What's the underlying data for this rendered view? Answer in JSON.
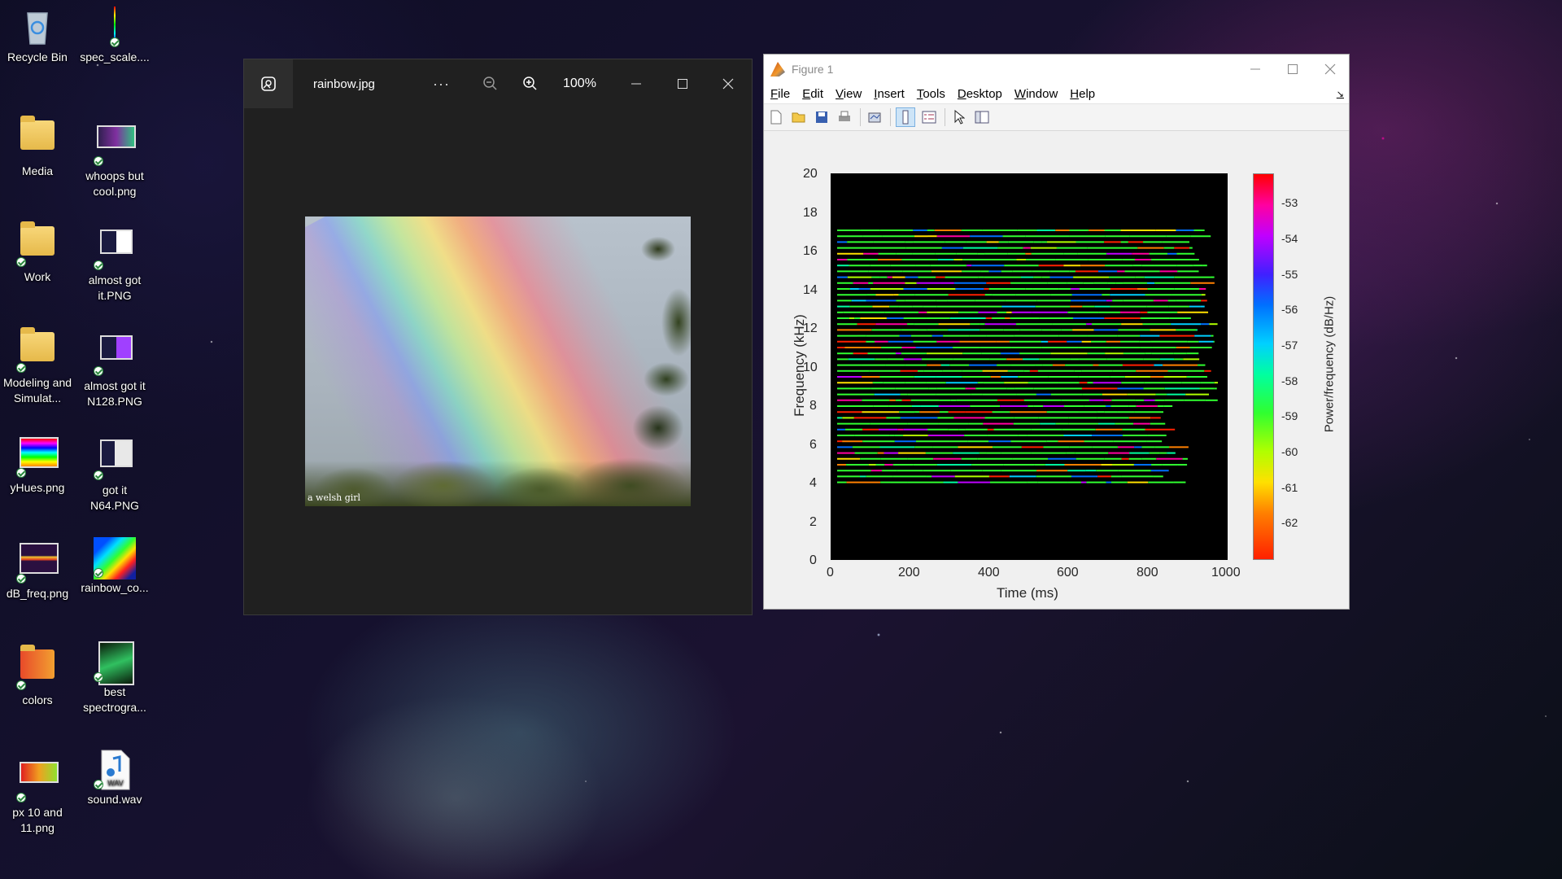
{
  "desktop": {
    "icons": [
      {
        "id": "recycle-bin",
        "label": "Recycle Bin"
      },
      {
        "id": "spec-scale",
        "label": "spec_scale...."
      },
      {
        "id": "media",
        "label": "Media"
      },
      {
        "id": "whoops",
        "label": "whoops but cool.png"
      },
      {
        "id": "work",
        "label": "Work"
      },
      {
        "id": "almost-got-it",
        "label": "almost got it.PNG"
      },
      {
        "id": "modeling",
        "label": "Modeling and Simulat..."
      },
      {
        "id": "almost-n128",
        "label": "almost got it N128.PNG"
      },
      {
        "id": "yhues",
        "label": "yHues.png"
      },
      {
        "id": "got-it-n64",
        "label": "got it N64.PNG"
      },
      {
        "id": "db-freq",
        "label": "dB_freq.png"
      },
      {
        "id": "rainbow-co",
        "label": "rainbow_co..."
      },
      {
        "id": "colors",
        "label": "colors"
      },
      {
        "id": "best-spectro",
        "label": "best spectrogra..."
      },
      {
        "id": "px-10-11",
        "label": "px 10 and 11.png"
      },
      {
        "id": "sound-wav",
        "label": "sound.wav"
      }
    ]
  },
  "photos_window": {
    "title": "rainbow.jpg",
    "more": "···",
    "zoom": "100%",
    "watermark": "a welsh girl"
  },
  "figure_window": {
    "title": "Figure 1",
    "menu": [
      "File",
      "Edit",
      "View",
      "Insert",
      "Tools",
      "Desktop",
      "Window",
      "Help"
    ]
  },
  "chart_data": {
    "type": "heatmap",
    "title": "",
    "xlabel": "Time (ms)",
    "ylabel": "Frequency (kHz)",
    "xlim": [
      0,
      1000
    ],
    "ylim": [
      0,
      20
    ],
    "xticks": [
      "0",
      "200",
      "400",
      "600",
      "800",
      "1000"
    ],
    "yticks": [
      "0",
      "2",
      "4",
      "6",
      "8",
      "10",
      "12",
      "14",
      "16",
      "18",
      "20"
    ],
    "colorbar": {
      "label": "Power/frequency (dB/Hz)",
      "ticks": [
        "-53",
        "-54",
        "-55",
        "-56",
        "-57",
        "-58",
        "-59",
        "-60",
        "-61",
        "-62"
      ],
      "range": [
        -63,
        -52.2
      ],
      "colormap": "hsv"
    },
    "grid": false
  }
}
